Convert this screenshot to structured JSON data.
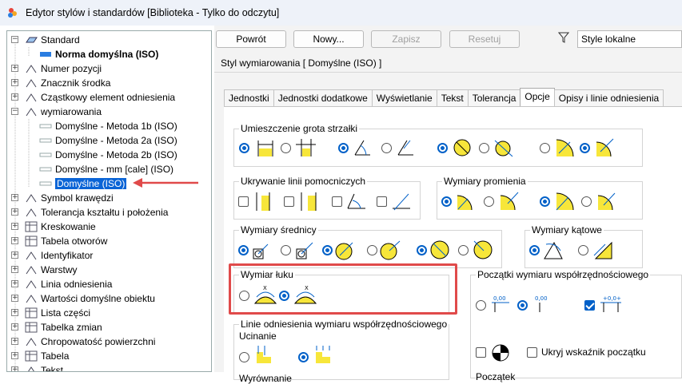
{
  "window": {
    "title": "Edytor stylów i standardów [Biblioteka - Tylko do odczytu]"
  },
  "tree": {
    "items": [
      {
        "label": "Standard",
        "level": 0,
        "expander": "−",
        "icon": "standard-icon"
      },
      {
        "label": "Norma domyślna (ISO)",
        "level": 1,
        "bold": true,
        "icon": "norm-icon"
      },
      {
        "label": "Numer pozycji",
        "level": 0,
        "expander": "+",
        "icon": "balloon-icon"
      },
      {
        "label": "Znacznik środka",
        "level": 0,
        "expander": "+",
        "icon": "center-mark-icon"
      },
      {
        "label": "Cząstkowy element odniesienia",
        "level": 0,
        "expander": "+",
        "icon": "datum-target-icon"
      },
      {
        "label": "wymiarowania",
        "level": 0,
        "expander": "−",
        "icon": "dimension-icon"
      },
      {
        "label": "Domyślne - Metoda 1b (ISO)",
        "level": 1,
        "icon": "dim-style-icon"
      },
      {
        "label": "Domyślne - Metoda 2a (ISO)",
        "level": 1,
        "icon": "dim-style-icon"
      },
      {
        "label": "Domyślne - Metoda 2b (ISO)",
        "level": 1,
        "icon": "dim-style-icon"
      },
      {
        "label": "Domyślne - mm [cale] (ISO)",
        "level": 1,
        "icon": "dim-style-icon"
      },
      {
        "label": "Domyślne (ISO)",
        "level": 1,
        "selected": true,
        "icon": "dim-style-icon"
      },
      {
        "label": "Symbol krawędzi",
        "level": 0,
        "expander": "+",
        "icon": "edge-symbol-icon"
      },
      {
        "label": "Tolerancja kształtu i położenia",
        "level": 0,
        "expander": "+",
        "icon": "fcf-icon"
      },
      {
        "label": "Kreskowanie",
        "level": 0,
        "expander": "+",
        "icon": "hatch-icon"
      },
      {
        "label": "Tabela otworów",
        "level": 0,
        "expander": "+",
        "icon": "hole-table-icon"
      },
      {
        "label": "Identyfikator",
        "level": 0,
        "expander": "+",
        "icon": "identifier-icon"
      },
      {
        "label": "Warstwy",
        "level": 0,
        "expander": "+",
        "icon": "layers-icon"
      },
      {
        "label": "Linia odniesienia",
        "level": 0,
        "expander": "+",
        "icon": "leader-icon"
      },
      {
        "label": "Wartości domyślne obiektu",
        "level": 0,
        "expander": "+",
        "icon": "object-defaults-icon"
      },
      {
        "label": "Lista części",
        "level": 0,
        "expander": "+",
        "icon": "parts-list-icon"
      },
      {
        "label": "Tabelka zmian",
        "level": 0,
        "expander": "+",
        "icon": "revision-table-icon"
      },
      {
        "label": "Chropowatość powierzchni",
        "level": 0,
        "expander": "+",
        "icon": "surface-icon"
      },
      {
        "label": "Tabela",
        "level": 0,
        "expander": "+",
        "icon": "table-icon"
      },
      {
        "label": "Tekst",
        "level": 0,
        "expander": "+",
        "icon": "text-icon"
      }
    ]
  },
  "toolbar": {
    "back": "Powrót",
    "new": "Nowy...",
    "save": "Zapisz",
    "reset": "Resetuj",
    "filter_value": "Style lokalne"
  },
  "style_title": "Styl wymiarowania [ Domyślne (ISO) ]",
  "tabs": [
    "Jednostki",
    "Jednostki dodatkowe",
    "Wyświetlanie",
    "Tekst",
    "Tolerancja",
    "Opcje",
    "Opisy i linie odniesienia"
  ],
  "active_tab": "Opcje",
  "groups": {
    "arrowhead": "Umieszczenie grota strzałki",
    "ext_hiding": "Ukrywanie linii pomocniczych",
    "radius": "Wymiary promienia",
    "diameter": "Wymiary średnicy",
    "angular": "Wymiary kątowe",
    "arc": "Wymiar łuku",
    "ordinate_origin": "Początki wymiaru współrzędnościowego",
    "ordinate_leader": "Linie odniesienia wymiaru współrzędnościowego",
    "trimming": "Ucinanie",
    "alignment": "Wyrównanie",
    "origin": "Początek"
  },
  "labels": {
    "hide_origin": "Ukryj wskaźnik początku"
  },
  "colors": {
    "accent": "#0060c8",
    "symbol_fill": "#f7e63a",
    "highlight": "#e04a4a",
    "selected": "#0a64d6"
  }
}
